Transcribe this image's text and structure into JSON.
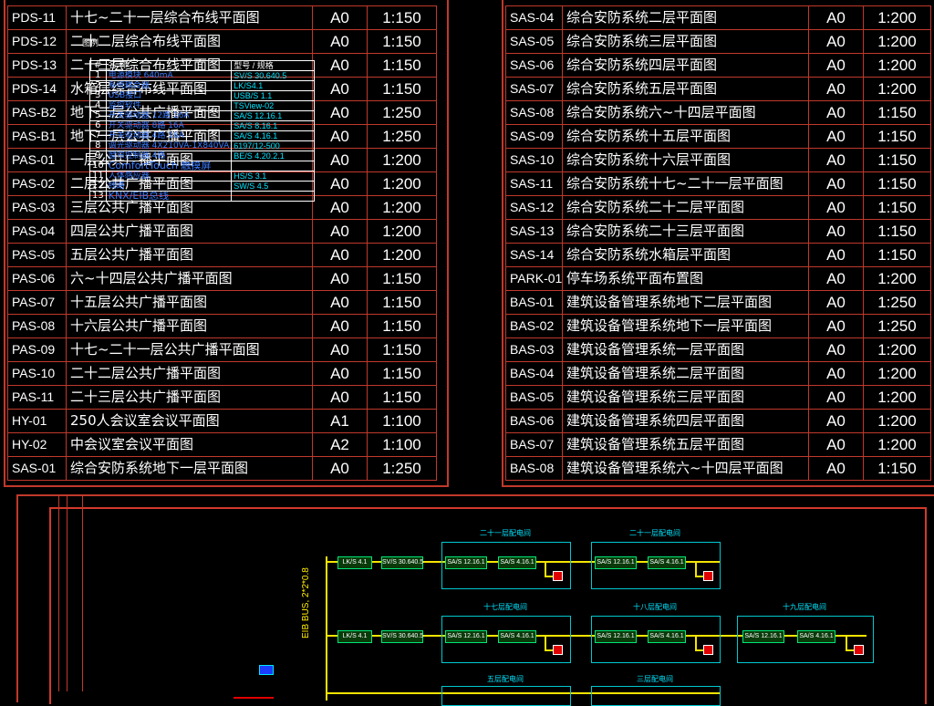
{
  "left_rows": [
    {
      "code": "PDS-11",
      "name": "十七~二十一层综合布线平面图",
      "size": "A0",
      "scale": "1:150"
    },
    {
      "code": "PDS-12",
      "name": "二十二层综合布线平面图",
      "size": "A0",
      "scale": "1:150"
    },
    {
      "code": "PDS-13",
      "name": "二十三层综合布线平面图",
      "size": "A0",
      "scale": "1:150"
    },
    {
      "code": "PDS-14",
      "name": "水箱层综合布线平面图",
      "size": "A0",
      "scale": "1:150"
    },
    {
      "code": "PAS-B2",
      "name": "地下二层公共广播平面图",
      "size": "A0",
      "scale": "1:250"
    },
    {
      "code": "PAS-B1",
      "name": "地下一层公共广播平面图",
      "size": "A0",
      "scale": "1:250"
    },
    {
      "code": "PAS-01",
      "name": "一层公共广播平面图",
      "size": "A0",
      "scale": "1:200"
    },
    {
      "code": "PAS-02",
      "name": "二层公共广播平面图",
      "size": "A0",
      "scale": "1:200"
    },
    {
      "code": "PAS-03",
      "name": "三层公共广播平面图",
      "size": "A0",
      "scale": "1:200"
    },
    {
      "code": "PAS-04",
      "name": "四层公共广播平面图",
      "size": "A0",
      "scale": "1:200"
    },
    {
      "code": "PAS-05",
      "name": "五层公共广播平面图",
      "size": "A0",
      "scale": "1:200"
    },
    {
      "code": "PAS-06",
      "name": "六~十四层公共广播平面图",
      "size": "A0",
      "scale": "1:150"
    },
    {
      "code": "PAS-07",
      "name": "十五层公共广播平面图",
      "size": "A0",
      "scale": "1:150"
    },
    {
      "code": "PAS-08",
      "name": "十六层公共广播平面图",
      "size": "A0",
      "scale": "1:150"
    },
    {
      "code": "PAS-09",
      "name": "十七~二十一层公共广播平面图",
      "size": "A0",
      "scale": "1:150"
    },
    {
      "code": "PAS-10",
      "name": "二十二层公共广播平面图",
      "size": "A0",
      "scale": "1:150"
    },
    {
      "code": "PAS-11",
      "name": "二十三层公共广播平面图",
      "size": "A0",
      "scale": "1:150"
    },
    {
      "code": "HY-01",
      "name": "250人会议室会议平面图",
      "size": "A1",
      "scale": "1:100"
    },
    {
      "code": "HY-02",
      "name": "中会议室会议平面图",
      "size": "A2",
      "scale": "1:100"
    },
    {
      "code": "SAS-01",
      "name": "综合安防系统地下一层平面图",
      "size": "A0",
      "scale": "1:250"
    }
  ],
  "right_rows": [
    {
      "code": "SAS-04",
      "name": "综合安防系统二层平面图",
      "size": "A0",
      "scale": "1:200"
    },
    {
      "code": "SAS-05",
      "name": "综合安防系统三层平面图",
      "size": "A0",
      "scale": "1:200"
    },
    {
      "code": "SAS-06",
      "name": "综合安防系统四层平面图",
      "size": "A0",
      "scale": "1:200"
    },
    {
      "code": "SAS-07",
      "name": "综合安防系统五层平面图",
      "size": "A0",
      "scale": "1:200"
    },
    {
      "code": "SAS-08",
      "name": "综合安防系统六~十四层平面图",
      "size": "A0",
      "scale": "1:150"
    },
    {
      "code": "SAS-09",
      "name": "综合安防系统十五层平面图",
      "size": "A0",
      "scale": "1:150"
    },
    {
      "code": "SAS-10",
      "name": "综合安防系统十六层平面图",
      "size": "A0",
      "scale": "1:150"
    },
    {
      "code": "SAS-11",
      "name": "综合安防系统十七~二十一层平面图",
      "size": "A0",
      "scale": "1:150"
    },
    {
      "code": "SAS-12",
      "name": "综合安防系统二十二层平面图",
      "size": "A0",
      "scale": "1:150"
    },
    {
      "code": "SAS-13",
      "name": "综合安防系统二十三层平面图",
      "size": "A0",
      "scale": "1:150"
    },
    {
      "code": "SAS-14",
      "name": "综合安防系统水箱层平面图",
      "size": "A0",
      "scale": "1:150"
    },
    {
      "code": "PARK-01",
      "name": "停车场系统平面布置图",
      "size": "A0",
      "scale": "1:200"
    },
    {
      "code": "BAS-01",
      "name": "建筑设备管理系统地下二层平面图",
      "size": "A0",
      "scale": "1:250"
    },
    {
      "code": "BAS-02",
      "name": "建筑设备管理系统地下一层平面图",
      "size": "A0",
      "scale": "1:250"
    },
    {
      "code": "BAS-03",
      "name": "建筑设备管理系统一层平面图",
      "size": "A0",
      "scale": "1:200"
    },
    {
      "code": "BAS-04",
      "name": "建筑设备管理系统二层平面图",
      "size": "A0",
      "scale": "1:200"
    },
    {
      "code": "BAS-05",
      "name": "建筑设备管理系统三层平面图",
      "size": "A0",
      "scale": "1:200"
    },
    {
      "code": "BAS-06",
      "name": "建筑设备管理系统四层平面图",
      "size": "A0",
      "scale": "1:200"
    },
    {
      "code": "BAS-07",
      "name": "建筑设备管理系统五层平面图",
      "size": "A0",
      "scale": "1:200"
    },
    {
      "code": "BAS-08",
      "name": "建筑设备管理系统六~十四层平面图",
      "size": "A0",
      "scale": "1:150"
    }
  ],
  "legend": {
    "title": "图例",
    "head_desc": "名    称",
    "head_model": "型号 / 规格",
    "rows": [
      {
        "n": "1",
        "desc": "电源模块 640mA",
        "model": "SV/S 30.640.5"
      },
      {
        "n": "2",
        "desc": "系统耦合器",
        "model": "LK/S4.1"
      },
      {
        "n": "3",
        "desc": "USB接口",
        "model": "USB/S 1.1"
      },
      {
        "n": "4",
        "desc": "监控软件",
        "model": "TSView-02"
      },
      {
        "n": "5",
        "desc": "开关驱动器 12路 16A",
        "model": "SA/S 12.16.1"
      },
      {
        "n": "6",
        "desc": "开关驱动器 8路 16A",
        "model": "SA/S 8.16.1"
      },
      {
        "n": "7",
        "desc": "开关驱动器 4路 16A",
        "model": "SA/S 4.16.1"
      },
      {
        "n": "8",
        "desc": "调光驱动器 4X210VA-1X840VA",
        "model": "6197/12-500"
      },
      {
        "n": "9",
        "desc": "窗帘控制器 4路",
        "model": "BE/S 4.20.2.1"
      },
      {
        "n": "10",
        "desc": "ComfortTouch 触摸屏",
        "model": ""
      },
      {
        "n": "11",
        "desc": "人体感应器",
        "model": "HS/S 3.1"
      },
      {
        "n": "12",
        "desc": "线路",
        "model": "SW/S 4.5"
      },
      {
        "n": "13",
        "desc": "KNX/EIB总线",
        "model": ""
      }
    ]
  },
  "riser_label": "EIB BUS, 2*2*0.8",
  "diagram": {
    "rooms": [
      {
        "label": "二十一层配电间"
      },
      {
        "label": "二十一层配电间"
      },
      {
        "label": "十七层配电间"
      },
      {
        "label": "十八层配电间"
      },
      {
        "label": "十九层配电间"
      },
      {
        "label": "五层配电间"
      },
      {
        "label": "三层配电间"
      }
    ],
    "devices": {
      "lk": "LK/S 4.1",
      "sv": "SV/S 30.640.5",
      "sa12": "SA/S 12.16.1",
      "sa4": "SA/S 4.16.1"
    }
  },
  "colors": {
    "frame": "#c0392b",
    "cyan": "#00e5ff",
    "wire": "#f4e400",
    "device": "#00e676"
  }
}
